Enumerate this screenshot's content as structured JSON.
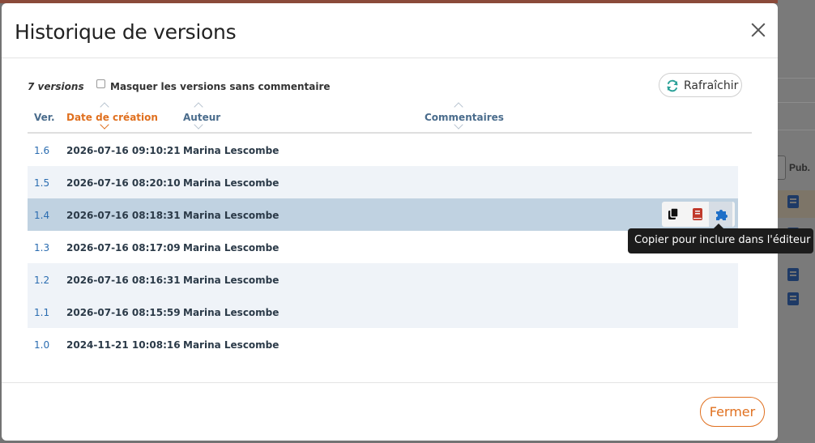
{
  "modal": {
    "title": "Historique de versions",
    "count_label": "7 versions",
    "filter_label": "Masquer les versions sans commentaire",
    "refresh_label": "Rafraîchir",
    "close_label": "Fermer"
  },
  "table": {
    "columns": {
      "version": "Ver.",
      "date": "Date de création",
      "author": "Auteur",
      "comments": "Commentaires"
    },
    "rows": [
      {
        "version": "1.6",
        "date": "2026-07-16 09:10:21",
        "author": "Marina Lescombe",
        "comment": ""
      },
      {
        "version": "1.5",
        "date": "2026-07-16 08:20:10",
        "author": "Marina Lescombe",
        "comment": ""
      },
      {
        "version": "1.4",
        "date": "2026-07-16 08:18:31",
        "author": "Marina Lescombe",
        "comment": ""
      },
      {
        "version": "1.3",
        "date": "2026-07-16 08:17:09",
        "author": "Marina Lescombe",
        "comment": ""
      },
      {
        "version": "1.2",
        "date": "2026-07-16 08:16:31",
        "author": "Marina Lescombe",
        "comment": ""
      },
      {
        "version": "1.1",
        "date": "2026-07-16 08:15:59",
        "author": "Marina Lescombe",
        "comment": ""
      },
      {
        "version": "1.0",
        "date": "2024-11-21 10:08:16",
        "author": "Marina Lescombe",
        "comment": ""
      }
    ],
    "selected_version": "1.4",
    "sorted_column": "date",
    "sort_direction": "descending"
  },
  "row_actions": {
    "icons": [
      "copy-icon",
      "book-icon",
      "puzzle-icon"
    ],
    "tooltip": "Copier pour inclure dans l'éditeur"
  },
  "background": {
    "column_label": "Pub."
  },
  "colors": {
    "accent": "#e0701f",
    "link": "#2a6cb0",
    "selected_row": "#c0d2e1",
    "alt_row": "#eff3f8",
    "refresh_icon": "#2aa198",
    "book_icon": "#c0392b",
    "puzzle_icon": "#1e6fc8"
  }
}
